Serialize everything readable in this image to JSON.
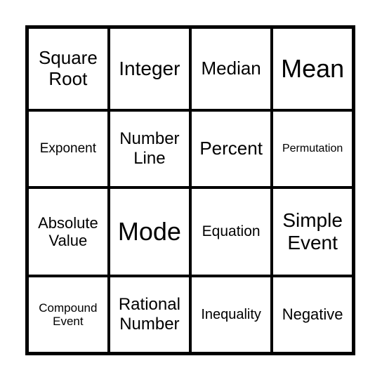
{
  "card": {
    "rows": [
      [
        {
          "text": "Square Root",
          "size": 26
        },
        {
          "text": "Integer",
          "size": 28
        },
        {
          "text": "Median",
          "size": 26
        },
        {
          "text": "Mean",
          "size": 36
        }
      ],
      [
        {
          "text": "Exponent",
          "size": 19
        },
        {
          "text": "Number Line",
          "size": 24
        },
        {
          "text": "Percent",
          "size": 26
        },
        {
          "text": "Permutation",
          "size": 16
        }
      ],
      [
        {
          "text": "Absolute Value",
          "size": 22
        },
        {
          "text": "Mode",
          "size": 36
        },
        {
          "text": "Equation",
          "size": 21
        },
        {
          "text": "Simple Event",
          "size": 28
        }
      ],
      [
        {
          "text": "Compound Event",
          "size": 17
        },
        {
          "text": "Rational Number",
          "size": 24
        },
        {
          "text": "Inequality",
          "size": 20
        },
        {
          "text": "Negative",
          "size": 22
        }
      ]
    ]
  }
}
